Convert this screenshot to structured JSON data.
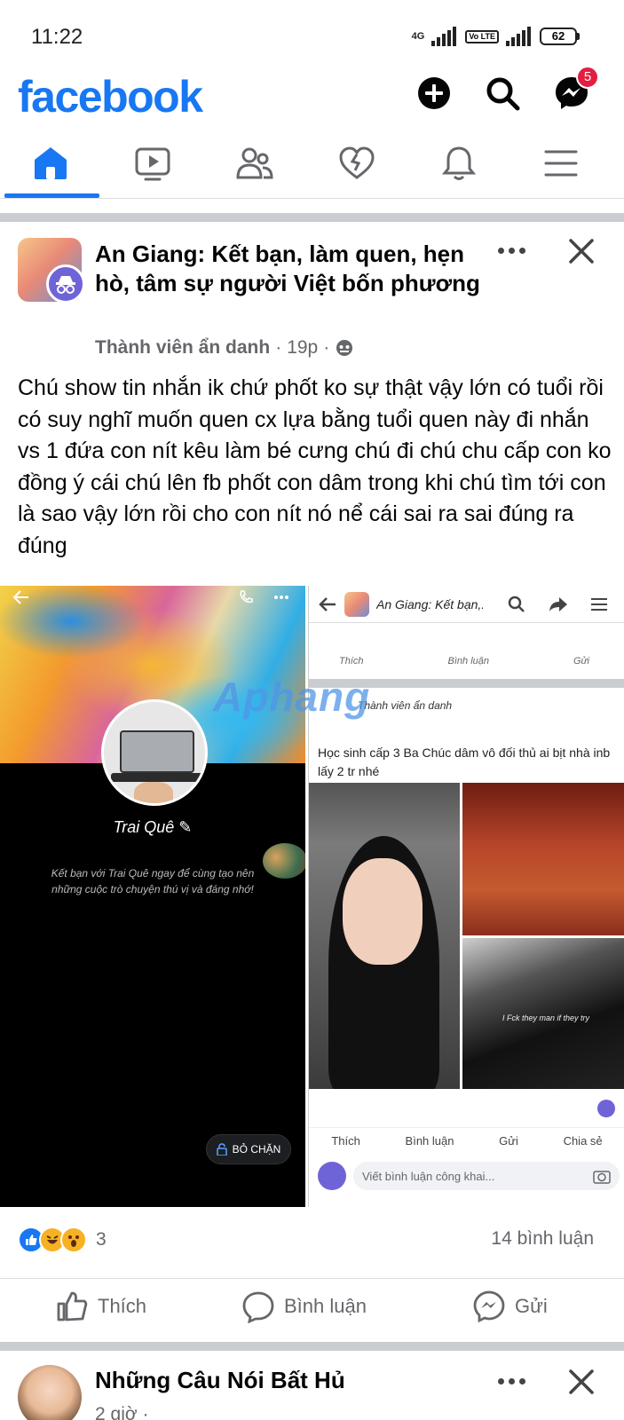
{
  "status_bar": {
    "time": "11:22",
    "network": "4G",
    "volte": "Vo LTE",
    "battery": "62"
  },
  "header": {
    "logo": "facebook",
    "messenger_badge": "5",
    "brand_color": "#1877f2"
  },
  "nav": {
    "tabs": [
      {
        "name": "home",
        "icon": "home-icon",
        "active": true
      },
      {
        "name": "watch",
        "icon": "video-icon"
      },
      {
        "name": "friends",
        "icon": "friends-icon"
      },
      {
        "name": "dating",
        "icon": "heart-icon"
      },
      {
        "name": "notifications",
        "icon": "bell-icon"
      },
      {
        "name": "menu",
        "icon": "menu-icon"
      }
    ]
  },
  "post": {
    "group_name": "An Giang: Kết bạn, làm quen, hẹn hò, tâm sự người Việt bốn phương",
    "author": "Thành viên ẩn danh",
    "time": "19p",
    "body": "Chú show tin nhắn ik chứ phốt ko sự thật vậy lớn có tuổi rồi có suy nghĩ muốn quen cx lựa bằng tuổi quen này đi nhắn vs 1 đứa con nít kêu làm bé cưng chú đi chú chu cấp con ko đồng ý cái chú lên fb phốt con dâm trong khi chú tìm tới con là sao vậy lớn rồi cho con nít nó nể cái sai ra sai đúng ra đúng",
    "left_image": {
      "name": "Trai Quê",
      "subtitle": "Kết bạn với Trai Quê ngay để cùng tạo nên những cuộc trò chuyện thú vị và đáng nhớ!",
      "unblock": "BỎ CHẶN"
    },
    "right_image": {
      "title": "An Giang: Kết bạn,...",
      "like": "Thích",
      "comment": "Bình luận",
      "send": "Gửi",
      "share": "Chia sẻ",
      "anon": "Thành viên ẩn danh",
      "caption": "Học sinh cấp 3 Ba Chúc dâm vô đối thủ ai bịt nhà inb lấy 2 tr nhé",
      "photo_text": "I Fck they man if they try",
      "comment_placeholder": "Viết bình luận công khai..."
    },
    "watermark": "Aphang",
    "reaction_count": "3",
    "comment_count": "14 bình luận",
    "actions": {
      "like": "Thích",
      "comment": "Bình luận",
      "send": "Gửi"
    }
  },
  "post2": {
    "title": "Những Câu Nói Bất Hủ",
    "time": "2 giờ ·"
  }
}
